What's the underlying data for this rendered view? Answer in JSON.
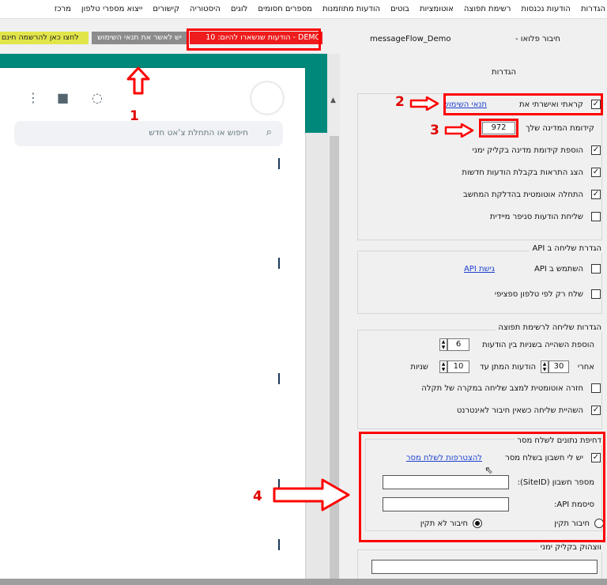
{
  "menu": [
    "הגדרות",
    "הודעות נכנסות",
    "רשימת תפוצה",
    "אוטומציות",
    "בוטים",
    "הודעות מתוזמנות",
    "מספרים חסומים",
    "לוגים",
    "היסטוריה",
    "קישורים",
    "ייצוא מספרי טלפון",
    "מרכז"
  ],
  "banner": {
    "yellow": "לחצו כאן להרשמה חינם",
    "grey": "יש לאשר את תנאי השימוש",
    "red": "DEMO - הודעות שנשארו להיום: 10"
  },
  "header": {
    "app_name": "messageFlow_Demo",
    "connection": "חיבור פלואו -",
    "settings": "הגדרות"
  },
  "whatsapp": {
    "search_placeholder": "חיפוש או התחלת צ'אט חדש"
  },
  "general": {
    "terms_label": "קראתי ואישרתי את",
    "terms_link": "תנאי השימוש",
    "prefix_label": "קידומת המדינה שלך",
    "prefix_value": "972",
    "add_prefix": "הוספת קידומת מדינה בקליק ימני",
    "show_alerts": "הצג התראות בקבלת הודעות חדשות",
    "auto_start": "התחלה אוטומטית בהדלקת המחשב",
    "instant_snippet": "שליחת הודעות סניפר מיידית"
  },
  "api": {
    "title": "הגדרת שליחה ב API",
    "use_api": "השתמש ב API",
    "api_access": "גישת API",
    "specific_phone": "שלח רק לפי טלפון ספציפי"
  },
  "broadcast": {
    "title": "הגדרות שליחה לרשימת תפוצה",
    "delay_label": "הוספת השהייה בשניות בין הודעות",
    "delay_value": "6",
    "after_label": "אחרי",
    "after_value": "30",
    "wait_label": "הודעות המתן עד",
    "wait_value": "10",
    "seconds_label": "שניות",
    "auto_retry": "חזרה אוטומטית למצב שליחה במקרה של תקלה",
    "pause_offline": "השהיית שליחה כשאין חיבור לאינטרנט"
  },
  "sms": {
    "title": "דחיפת נתונים לשלח מסר",
    "has_account": "יש לי חשבון בשלח מסר",
    "join_link": "להצטרפות לשלח מסר",
    "account_label": "מספר חשבון (SiteID):",
    "api_password_label": "סיסמת API:",
    "valid_label": "חיבור תקין",
    "invalid_label": "חיבור לא תקין"
  },
  "right_click": {
    "title": "ווצהוק בקליק ימני"
  },
  "annotations": {
    "n1": "1",
    "n2": "2",
    "n3": "3",
    "n4": "4"
  },
  "colors": {
    "annotation": "#ff0000",
    "whatsapp_header": "#00897b",
    "link": "#1a3fd0",
    "demo_red": "#ee1c1c",
    "demo_yellow": "#e2e54a"
  }
}
